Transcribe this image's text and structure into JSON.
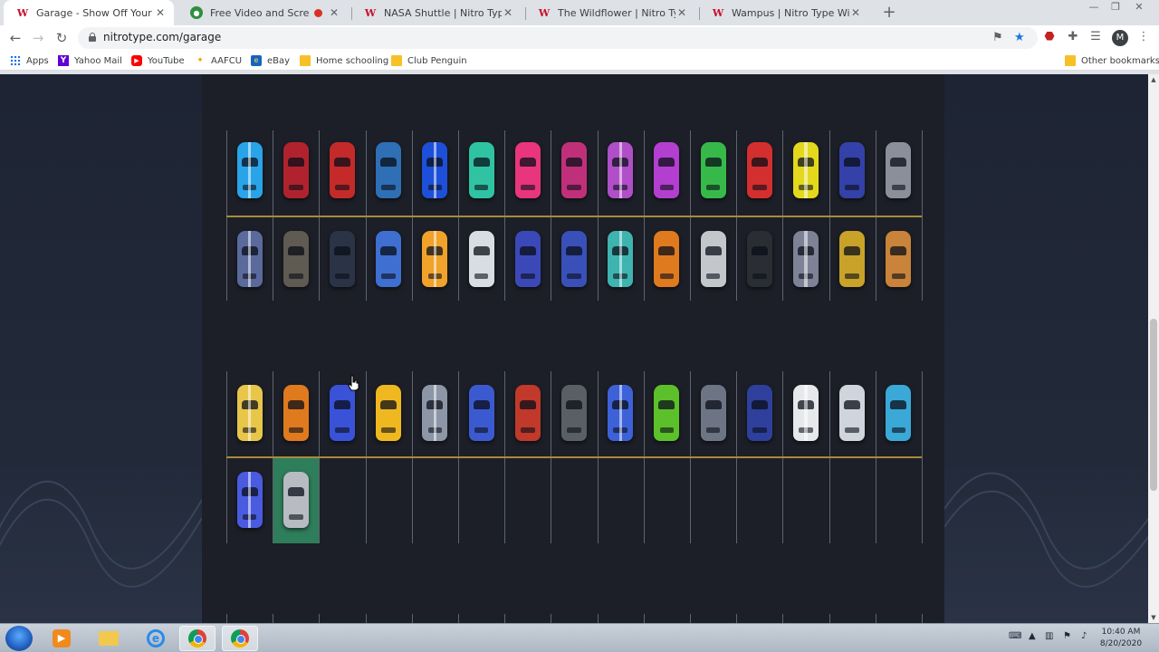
{
  "browser": {
    "tabs": [
      {
        "title": "Garage - Show Off Your Cars | Nitro",
        "icon": "nitro-type-icon",
        "active": true
      },
      {
        "title": "Free Video and Screen Recorder",
        "icon": "recorder-icon",
        "active": false,
        "recording": true
      },
      {
        "title": "NASA Shuttle | Nitro Type Wiki | Fandom",
        "icon": "fandom-icon",
        "active": false
      },
      {
        "title": "The Wildflower | Nitro Type Wiki | Fandom",
        "icon": "fandom-icon",
        "active": false
      },
      {
        "title": "Wampus | Nitro Type Wiki | Fandom",
        "icon": "fandom-icon",
        "active": false
      }
    ],
    "tab_close_glyph": "✕",
    "new_tab_glyph": "+",
    "address": "nitrotype.com/garage",
    "profile_initial": "M",
    "bookmarks": [
      {
        "label": "Apps",
        "icon": "apps-icon"
      },
      {
        "label": "Yahoo Mail",
        "icon": "yahoo-icon"
      },
      {
        "label": "YouTube",
        "icon": "youtube-icon"
      },
      {
        "label": "AAFCU",
        "icon": "aafcu-icon"
      },
      {
        "label": "eBay",
        "icon": "ebay-icon"
      },
      {
        "label": "Home schooling",
        "icon": "folder-icon"
      },
      {
        "label": "Club Penguin",
        "icon": "folder-icon"
      }
    ],
    "other_bookmarks": "Other bookmarks"
  },
  "garage": {
    "section_a": {
      "row_top_colors": [
        "#2aa4e8",
        "#b0232e",
        "#c42a2a",
        "#2f6fb5",
        "#1e4fd8",
        "#2fc3a3",
        "#e8357e",
        "#c0307a",
        "#b04fc7",
        "#b33fd0",
        "#37b94a",
        "#d32f2f",
        "#e3d81c",
        "#3441a8",
        "#8a8f99"
      ],
      "row_bottom_colors": [
        "#5a6a9c",
        "#5f5a52",
        "#2b3446",
        "#3f6fd0",
        "#f0a22a",
        "#d8dde3",
        "#3b49b8",
        "#3850b8",
        "#3fb3b0",
        "#e07a1f",
        "#c3c7cc",
        "#2a2d33",
        "#7d8296",
        "#c9a22a",
        "#c9833a"
      ]
    },
    "section_b": {
      "row_top_colors": [
        "#e8c64a",
        "#e07a1f",
        "#3a52d8",
        "#f0b820",
        "#8c96a6",
        "#3c5ad0",
        "#c0392b",
        "#5a5f66",
        "#3d62d8",
        "#5cc02a",
        "#6d7585",
        "#2e3f9c",
        "#e6e8ec",
        "#d0d4dc",
        "#3ba9d8"
      ],
      "row_bottom_colors": [
        "#4a5be0",
        "#b8bcc2"
      ]
    },
    "highlighted_slot_color": "#2e7d5b"
  },
  "taskbar": {
    "clock_time": "10:40 AM",
    "clock_date": "8/20/2020"
  }
}
